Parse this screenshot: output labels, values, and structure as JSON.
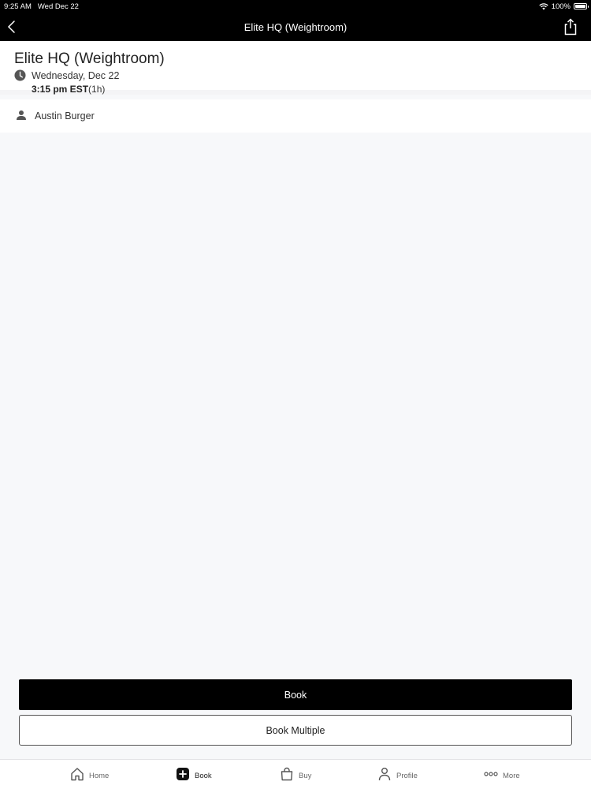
{
  "status_bar": {
    "time": "9:25 AM",
    "date": "Wed Dec 22",
    "battery": "100%"
  },
  "nav": {
    "title": "Elite HQ (Weightroom)"
  },
  "event": {
    "title": "Elite HQ (Weightroom)",
    "date": "Wednesday, Dec 22",
    "time": "3:15 pm EST",
    "duration": "(1h)"
  },
  "instructor": {
    "name": "Austin Burger"
  },
  "actions": {
    "book_label": "Book",
    "book_multiple_label": "Book Multiple"
  },
  "tabs": [
    {
      "label": "Home",
      "icon": "home-icon"
    },
    {
      "label": "Book",
      "icon": "plus-square-icon",
      "active": true
    },
    {
      "label": "Buy",
      "icon": "shopping-bag-icon"
    },
    {
      "label": "Profile",
      "icon": "person-icon"
    },
    {
      "label": "More",
      "icon": "more-dots-icon"
    }
  ],
  "colors": {
    "header_bg": "#000000",
    "primary_button": "#000000",
    "page_bg": "#f7f8fa"
  }
}
